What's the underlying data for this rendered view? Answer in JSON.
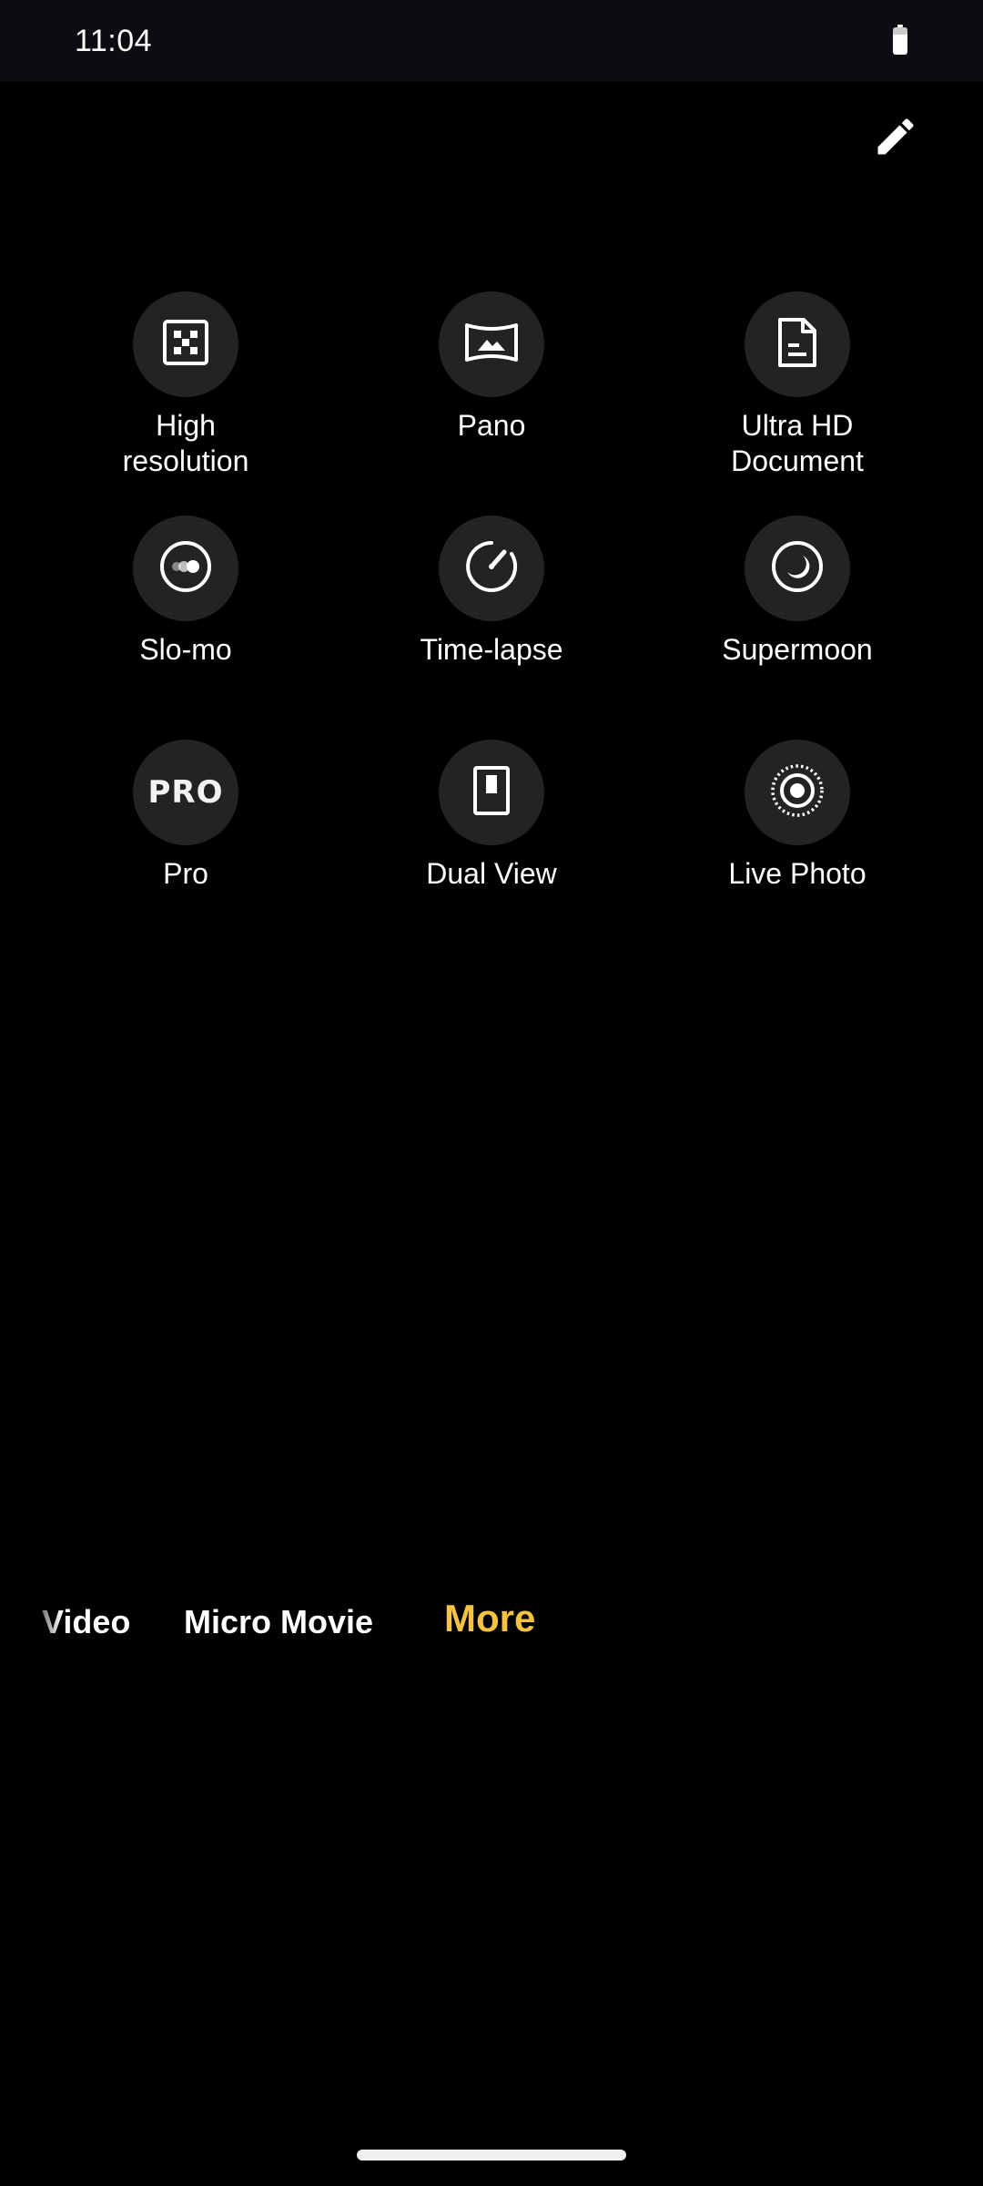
{
  "status_bar": {
    "time": "11:04",
    "battery_icon": "battery-icon"
  },
  "toolbar": {
    "edit_icon": "pencil-icon"
  },
  "modes": [
    {
      "label": "High\nresolution",
      "icon": "high-resolution-icon"
    },
    {
      "label": "Pano",
      "icon": "panorama-icon"
    },
    {
      "label": "Ultra HD\nDocument",
      "icon": "document-icon"
    },
    {
      "label": "Slo-mo",
      "icon": "slow-motion-icon"
    },
    {
      "label": "Time-lapse",
      "icon": "time-lapse-icon"
    },
    {
      "label": "Supermoon",
      "icon": "supermoon-icon"
    },
    {
      "label": "Pro",
      "icon": "pro-icon",
      "icon_text": "PRO"
    },
    {
      "label": "Dual View",
      "icon": "dual-view-icon"
    },
    {
      "label": "Live Photo",
      "icon": "live-photo-icon"
    }
  ],
  "mode_selector": {
    "tabs": [
      {
        "label": "Video",
        "active": false
      },
      {
        "label": "Micro Movie",
        "active": false
      },
      {
        "label": "More",
        "active": true
      }
    ]
  },
  "colors": {
    "background": "#000000",
    "status_bar": "#0b0d11",
    "icon_circle": "#232323",
    "active_tab": "#f5c242"
  }
}
